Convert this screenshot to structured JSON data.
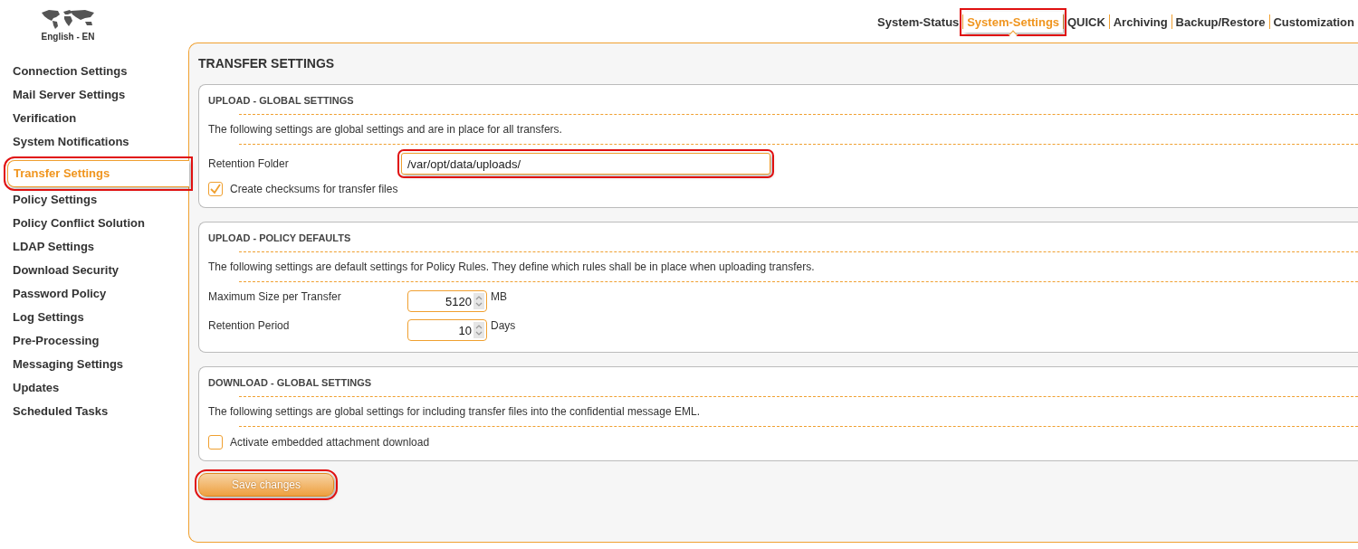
{
  "language": {
    "label": "English - EN"
  },
  "top_nav": [
    {
      "label": "System-Status",
      "selected": false,
      "highlighted": false
    },
    {
      "label": "System-Settings",
      "selected": true,
      "highlighted": true
    },
    {
      "label": "QUICK",
      "selected": false,
      "highlighted": false
    },
    {
      "label": "Archiving",
      "selected": false,
      "highlighted": false
    },
    {
      "label": "Backup/Restore",
      "selected": false,
      "highlighted": false
    },
    {
      "label": "Customization",
      "selected": false,
      "highlighted": false
    }
  ],
  "sidebar": {
    "items": [
      {
        "label": "Connection Settings",
        "selected": false,
        "highlighted": false
      },
      {
        "label": "Mail Server Settings",
        "selected": false,
        "highlighted": false
      },
      {
        "label": "Verification",
        "selected": false,
        "highlighted": false
      },
      {
        "label": "System Notifications",
        "selected": false,
        "highlighted": false
      },
      {
        "label": "Transfer Settings",
        "selected": true,
        "highlighted": true
      },
      {
        "label": "Policy Settings",
        "selected": false,
        "highlighted": false
      },
      {
        "label": "Policy Conflict Solution",
        "selected": false,
        "highlighted": false
      },
      {
        "label": "LDAP Settings",
        "selected": false,
        "highlighted": false
      },
      {
        "label": "Download Security",
        "selected": false,
        "highlighted": false
      },
      {
        "label": "Password Policy",
        "selected": false,
        "highlighted": false
      },
      {
        "label": "Log Settings",
        "selected": false,
        "highlighted": false
      },
      {
        "label": "Pre-Processing",
        "selected": false,
        "highlighted": false
      },
      {
        "label": "Messaging Settings",
        "selected": false,
        "highlighted": false
      },
      {
        "label": "Updates",
        "selected": false,
        "highlighted": false
      },
      {
        "label": "Scheduled Tasks",
        "selected": false,
        "highlighted": false
      }
    ]
  },
  "page_title": "TRANSFER SETTINGS",
  "sections": [
    {
      "title": "UPLOAD - GLOBAL SETTINGS",
      "description": "The following settings are global settings and are in place for all transfers.",
      "fields": [
        {
          "kind": "text",
          "label": "Retention Folder",
          "value": "/var/opt/data/uploads/",
          "highlighted": true
        },
        {
          "kind": "checkbox",
          "label": "Create checksums for transfer files",
          "checked": true
        }
      ]
    },
    {
      "title": "UPLOAD - POLICY DEFAULTS",
      "description": "The following settings are default settings for Policy Rules. They define which rules shall be in place when uploading transfers.",
      "fields": [
        {
          "kind": "number",
          "label": "Maximum Size per Transfer",
          "value": "5120",
          "unit": "MB"
        },
        {
          "kind": "number",
          "label": "Retention Period",
          "value": "10",
          "unit": "Days"
        }
      ]
    },
    {
      "title": "DOWNLOAD - GLOBAL SETTINGS",
      "description": "The following settings are global settings for including transfer files into the confidential message EML.",
      "fields": [
        {
          "kind": "checkbox",
          "label": "Activate embedded attachment download",
          "checked": false
        }
      ]
    }
  ],
  "save_button": {
    "label": "Save changes",
    "highlighted": true
  }
}
